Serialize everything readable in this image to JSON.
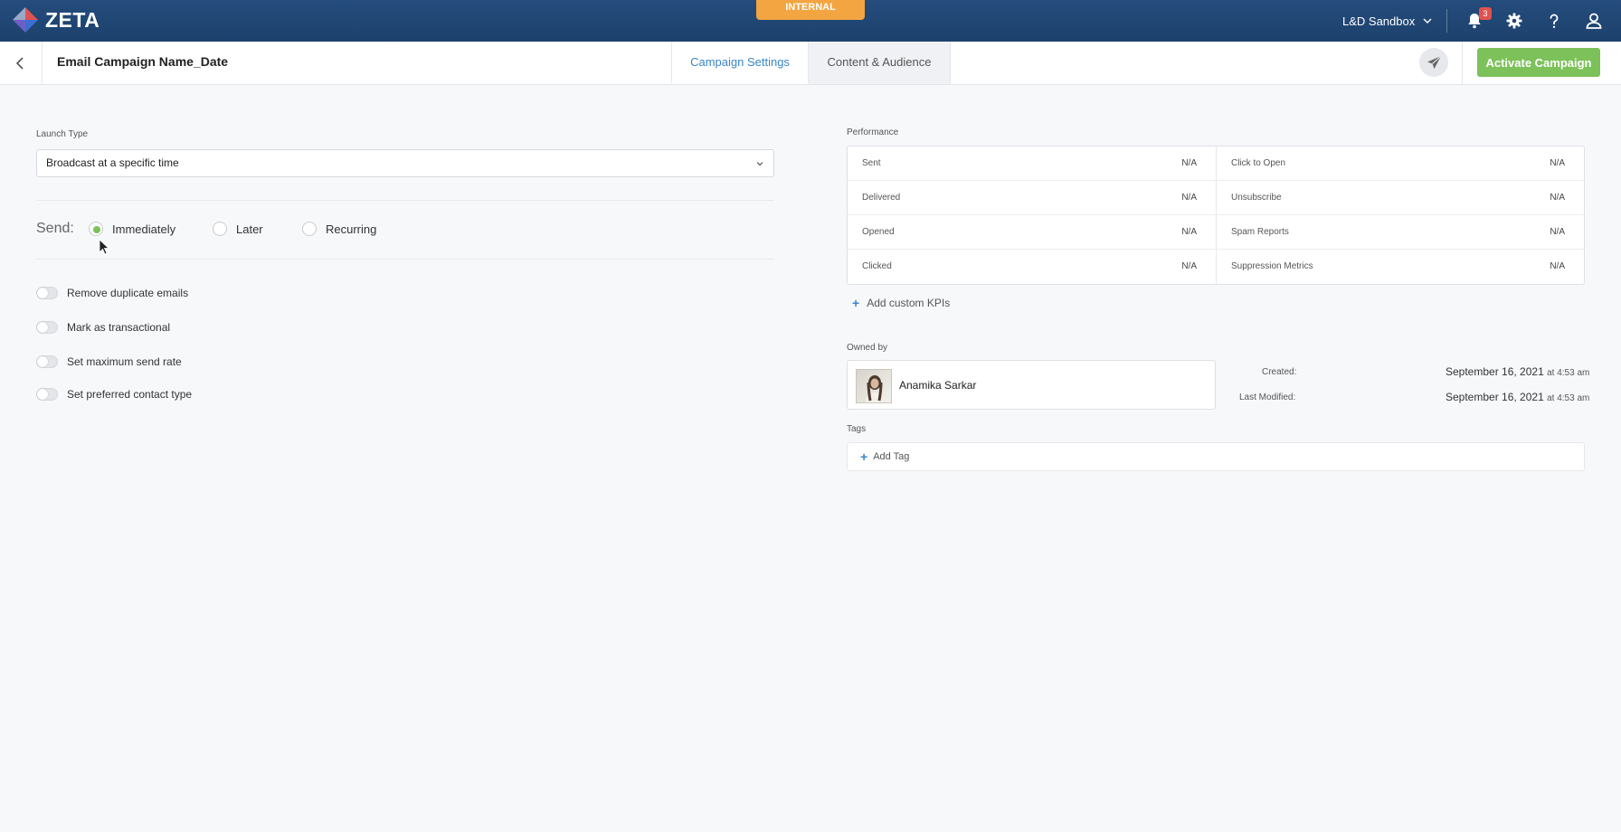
{
  "header": {
    "brand": "ZETA",
    "environment_badge": "INTERNAL",
    "workspace": "L&D Sandbox",
    "notification_count": "3"
  },
  "subheader": {
    "campaign_title": "Email Campaign Name_Date",
    "tabs": [
      {
        "label": "Campaign Settings",
        "active": true
      },
      {
        "label": "Content & Audience",
        "active": false
      }
    ],
    "activate_label": "Activate Campaign"
  },
  "settings": {
    "launch_type_label": "Launch Type",
    "launch_type_value": "Broadcast at a specific time",
    "send_label": "Send:",
    "send_options": [
      {
        "label": "Immediately",
        "selected": true
      },
      {
        "label": "Later",
        "selected": false
      },
      {
        "label": "Recurring",
        "selected": false
      }
    ],
    "toggles": [
      {
        "label": "Remove duplicate emails",
        "on": false
      },
      {
        "label": "Mark as transactional",
        "on": false
      },
      {
        "label": "Set maximum send rate",
        "on": false
      },
      {
        "label": "Set preferred contact type",
        "on": false
      }
    ]
  },
  "performance": {
    "label": "Performance",
    "left": [
      {
        "metric": "Sent",
        "value": "N/A"
      },
      {
        "metric": "Delivered",
        "value": "N/A"
      },
      {
        "metric": "Opened",
        "value": "N/A"
      },
      {
        "metric": "Clicked",
        "value": "N/A"
      }
    ],
    "right": [
      {
        "metric": "Click to Open",
        "value": "N/A"
      },
      {
        "metric": "Unsubscribe",
        "value": "N/A"
      },
      {
        "metric": "Spam Reports",
        "value": "N/A"
      },
      {
        "metric": "Suppression Metrics",
        "value": "N/A"
      }
    ],
    "add_kpi_label": "Add custom KPIs"
  },
  "ownership": {
    "owned_by_label": "Owned by",
    "owner_name": "Anamika Sarkar",
    "created_label": "Created:",
    "created_date": "September 16, 2021",
    "created_time": "at 4:53 am",
    "modified_label": "Last Modified:",
    "modified_date": "September 16, 2021",
    "modified_time": "at 4:53 am"
  },
  "tags": {
    "label": "Tags",
    "add_label": "Add Tag"
  },
  "colors": {
    "nav_bg": "#1f4473",
    "accent_blue": "#3a86c8",
    "accent_green": "#7dc15a",
    "badge_orange": "#f2a541",
    "notification_red": "#e0524f"
  }
}
